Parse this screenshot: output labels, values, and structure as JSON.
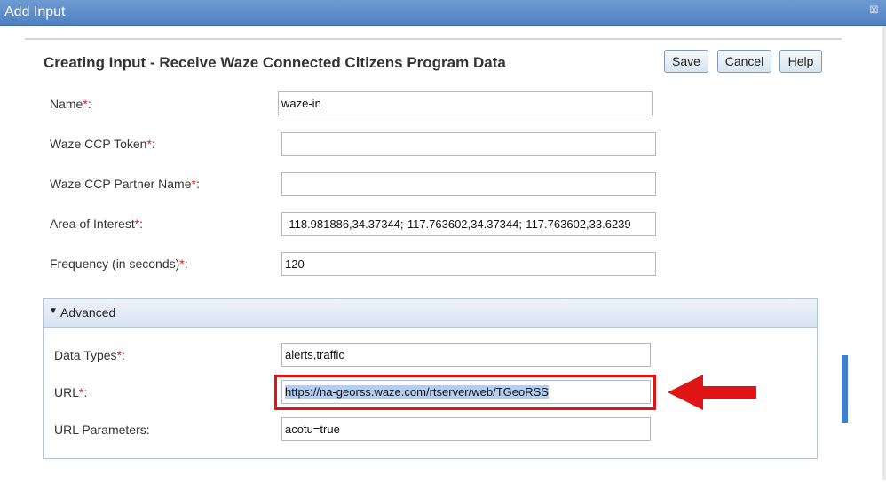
{
  "window": {
    "title": "Add Input",
    "close_glyph": "⊠"
  },
  "dialog": {
    "heading": "Creating Input - Receive Waze Connected Citizens Program Data"
  },
  "buttons": {
    "save": "Save",
    "cancel": "Cancel",
    "help": "Help"
  },
  "required_marker": "*",
  "fields": {
    "name": {
      "label": "Name",
      "value": "waze-in"
    },
    "token": {
      "label": "Waze CCP Token",
      "value": ""
    },
    "partner": {
      "label": "Waze CCP Partner Name",
      "value": ""
    },
    "aoi": {
      "label": "Area of Interest",
      "value": "-118.981886,34.37344;-117.763602,34.37344;-117.763602,33.6239"
    },
    "frequency": {
      "label": "Frequency (in seconds)",
      "value": "120"
    }
  },
  "advanced": {
    "header": "Advanced",
    "caret": "▼",
    "data_types": {
      "label": "Data Types",
      "value": "alerts,traffic"
    },
    "url": {
      "label": "URL",
      "value": "https://na-georss.waze.com/rtserver/web/TGeoRSS"
    },
    "url_params": {
      "label": "URL Parameters",
      "value": "acotu=true"
    }
  },
  "colors": {
    "annotation": "#e01414",
    "titlebar": "#5a89c8"
  }
}
